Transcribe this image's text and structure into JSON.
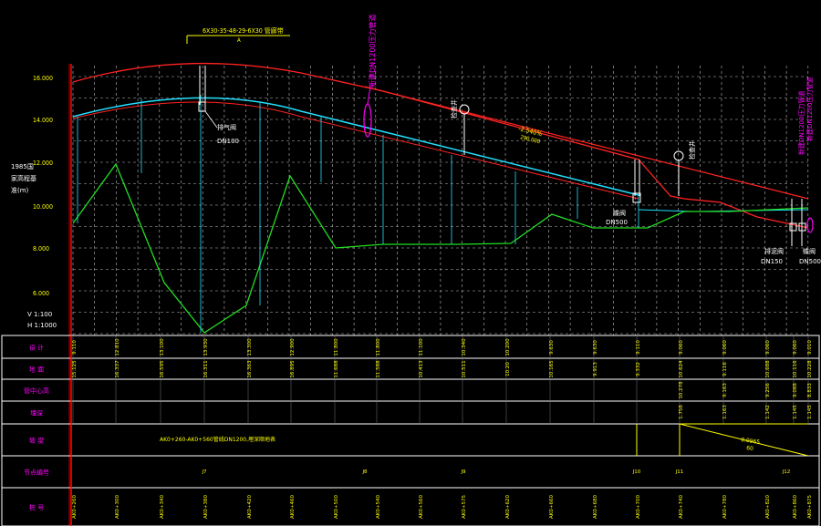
{
  "header_label": {
    "top": "6X30-35-48-29-6X30 管廊带",
    "bottom": "A"
  },
  "left_title": [
    "1985国",
    "家高程基",
    "准(m)"
  ],
  "y_ticks": [
    "16.000",
    "14.000",
    "12.000",
    "10.000",
    "8.000",
    "6.000"
  ],
  "scale": {
    "v": "V 1:100",
    "h": "H 1:1000"
  },
  "annotations": {
    "mag_top": "新建DN1200压力管道",
    "mag_right_1": "新建DN1200压力管道",
    "mag_right_2": "新建DN1200压力管道",
    "vent1": "DN100",
    "vent1_label": "排气阀",
    "mid_label": "检查井",
    "right_label": "检查井",
    "valve_label": "蝶阀",
    "valve_dn": "DN500",
    "drain_label": "排泥阀",
    "drain_dn": "DN150",
    "end_label": "蝶阀",
    "end_dn": "DN500",
    "slope_top": "-2.540%",
    "slope_bottom": "290.000"
  },
  "rows": [
    {
      "label": "设 计",
      "values": [
        "9.110",
        "12.810",
        "13.100",
        "13.930",
        "13.300",
        "12.900",
        "11.800",
        "11.800",
        "11.100",
        "10.340",
        "10.200",
        "9.630",
        "9.630",
        "9.110",
        "9.060",
        "9.060",
        "9.060",
        "9.060",
        "9.010"
      ]
    },
    {
      "label": "地 面",
      "values": [
        "15.125",
        "16.337",
        "16.595",
        "16.311",
        "16.363",
        "16.895",
        "11.688",
        "11.588",
        "10.413",
        "10.511",
        "10.20",
        "10.165",
        "9.913",
        "9.332",
        "10.624",
        "9.116",
        "10.688",
        "10.116",
        "10.228"
      ]
    },
    {
      "label": "管中心高",
      "values": [
        "10.278",
        "9.163",
        "9.256",
        "9.088",
        "8.833"
      ]
    },
    {
      "label": "埋深",
      "values": [
        "1.758",
        "1.163",
        "1.142",
        "1.145",
        "1.145"
      ]
    },
    {
      "label": "坡 度",
      "values": [
        "AK0+260-AK0+560管线DN1200,埋深顺地表",
        "0.0965",
        "60"
      ]
    },
    {
      "label": "节点编号",
      "values": [
        "J7",
        "J8",
        "J9",
        "J10",
        "J11",
        "J12"
      ]
    },
    {
      "label": "桩 号",
      "values": [
        "AK0+260",
        "AK0+300",
        "AK0+340",
        "AK0+380",
        "AK0+420",
        "AK0+460",
        "AK0+500",
        "AK0+540",
        "AK0+560",
        "AK0+575",
        "AK0+620",
        "AK0+660",
        "AK0+680",
        "AK0+700",
        "AK0+740",
        "AK0+780",
        "AK0+820",
        "AK0+860",
        "AK0+875"
      ]
    }
  ]
}
